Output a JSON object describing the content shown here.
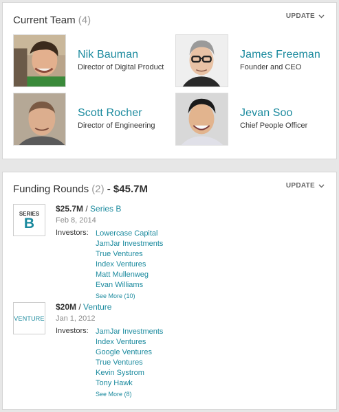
{
  "team": {
    "title": "Current Team",
    "count": "(4)",
    "update_label": "UPDATE",
    "members": [
      {
        "name": "Nik Bauman",
        "role": "Director of Digital Product"
      },
      {
        "name": "James Freeman",
        "role": "Founder and CEO"
      },
      {
        "name": "Scott Rocher",
        "role": "Director of Engineering"
      },
      {
        "name": "Jevan Soo",
        "role": "Chief People Officer"
      }
    ]
  },
  "funding": {
    "title": "Funding Rounds",
    "count": "(2)",
    "total": "- $45.7M",
    "update_label": "UPDATE",
    "investors_label": "Investors:",
    "rounds": [
      {
        "badge_small": "SERIES",
        "badge_big": "B",
        "amount": "$25.7M",
        "separator": " / ",
        "type": "Series B",
        "date": "Feb 8, 2014",
        "investors": [
          "Lowercase Capital",
          "JamJar Investments",
          "True Ventures",
          "Index Ventures",
          "Matt Mullenweg",
          "Evan Williams"
        ],
        "see_more": "See More (10)"
      },
      {
        "badge_word": "VENTURE",
        "amount": "$20M",
        "separator": " / ",
        "type": "Venture",
        "date": "Jan 1, 2012",
        "investors": [
          "JamJar Investments",
          "Index Ventures",
          "Google Ventures",
          "True Ventures",
          "Kevin Systrom",
          "Tony Hawk"
        ],
        "see_more": "See More (8)"
      }
    ]
  },
  "colors": {
    "accent": "#1b8a9e",
    "muted": "#999999",
    "page_bg": "#e7e7e7"
  }
}
